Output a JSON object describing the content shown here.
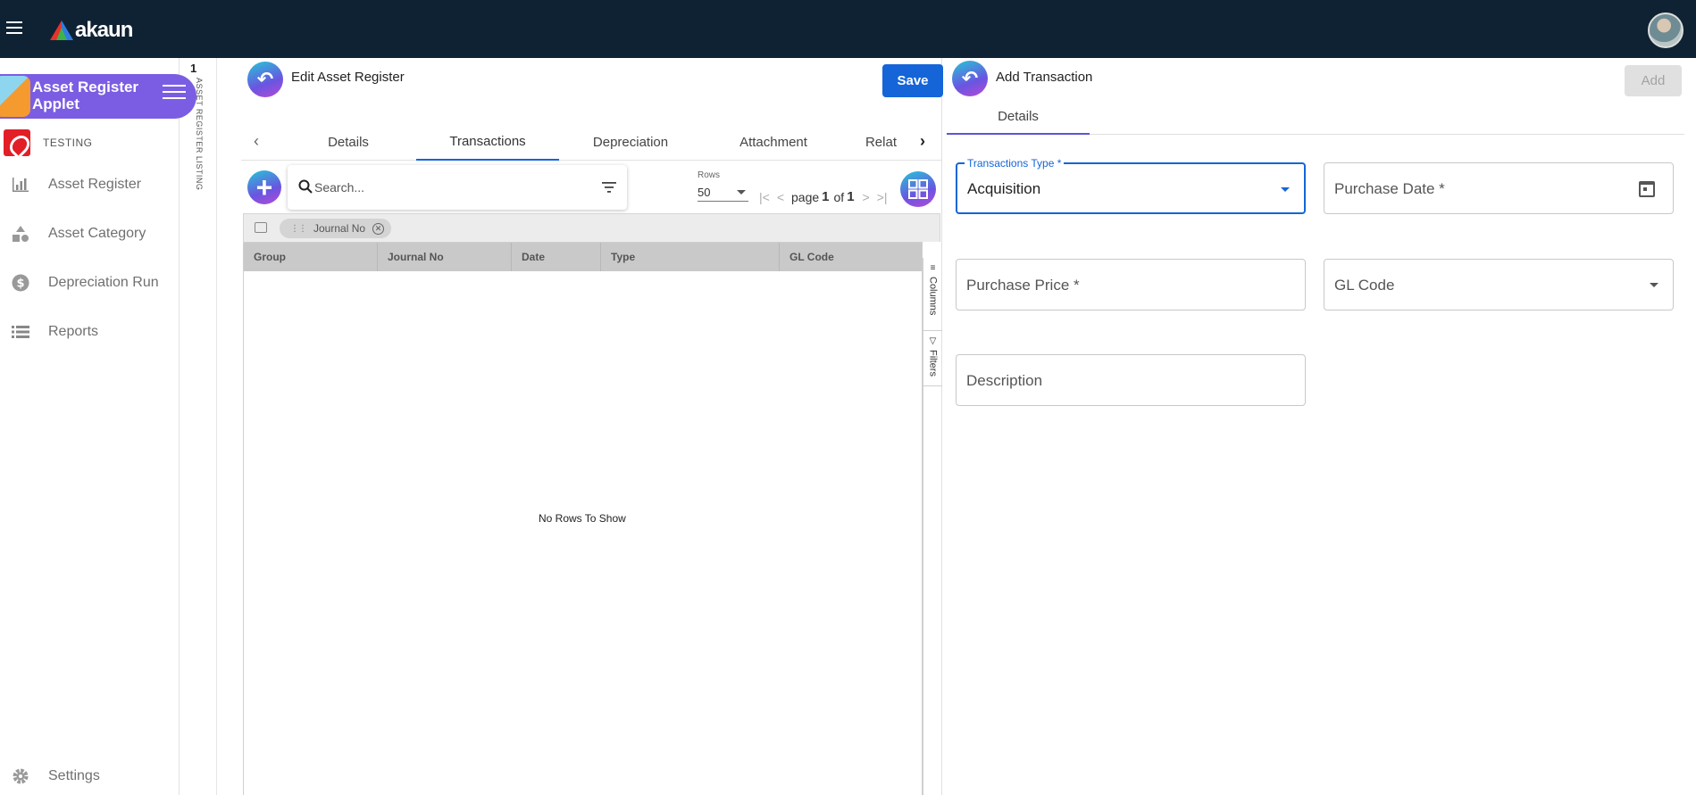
{
  "app": {
    "brand": "akaun"
  },
  "sidebar": {
    "applet_title_line1": "Asset Register",
    "applet_title_line2": "Applet",
    "org": "TESTING",
    "items": [
      {
        "label": "Asset Register",
        "icon": "bar-chart-icon"
      },
      {
        "label": "Asset Category",
        "icon": "shapes-icon"
      },
      {
        "label": "Depreciation Run",
        "icon": "dollar-circle-icon"
      },
      {
        "label": "Reports",
        "icon": "list-icon"
      }
    ],
    "settings": "Settings"
  },
  "listing_strip": {
    "number": "1",
    "label": "ASSET REGISTER LISTING"
  },
  "edit_panel": {
    "title": "Edit Asset Register",
    "save_label": "Save",
    "tabs": [
      {
        "label": "Details"
      },
      {
        "label": "Transactions",
        "active": true
      },
      {
        "label": "Depreciation"
      },
      {
        "label": "Attachment"
      },
      {
        "label": "Relat"
      }
    ],
    "search_placeholder": "Search...",
    "rows_label": "Rows",
    "rows_value": "50",
    "pager": {
      "page_word": "page",
      "page": "1",
      "of_word": "of",
      "total": "1"
    },
    "group_chip": "Journal No",
    "columns": [
      "Group",
      "Journal No",
      "Date",
      "Type",
      "GL Code"
    ],
    "empty_text": "No Rows To Show",
    "side_tools": [
      "Columns",
      "Filters"
    ]
  },
  "add_panel": {
    "title": "Add Transaction",
    "add_label": "Add",
    "tab": "Details",
    "fields": {
      "transactions_type_label": "Transactions Type *",
      "transactions_type_value": "Acquisition",
      "purchase_date": "Purchase Date *",
      "purchase_price": "Purchase Price *",
      "gl_code": "GL Code",
      "description": "Description"
    }
  },
  "colors": {
    "topbar": "#0f2233",
    "accent": "#1565d8",
    "applet_banner": "#7b5de3"
  }
}
